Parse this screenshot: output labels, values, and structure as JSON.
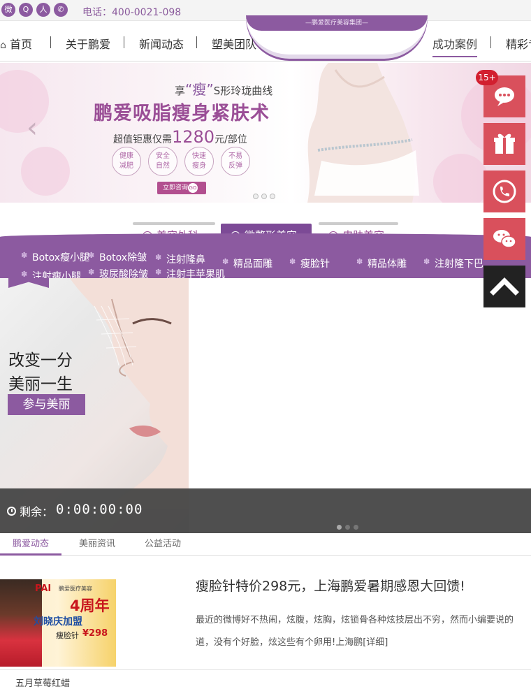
{
  "topbar": {
    "social_icons": [
      "weibo-icon",
      "qzone-icon",
      "renren-icon",
      "wechat-icon"
    ],
    "phone_text": "电话：400-0021-098"
  },
  "nav": {
    "items": [
      "首页",
      "关于鹏爱",
      "新闻动态",
      "塑美团队",
      "成功案例",
      "精彩专题"
    ],
    "active_index": 4,
    "emblem_text": "—鹏爱医疗美容集团—"
  },
  "banner": {
    "subtitle_pre": "享",
    "subtitle_highlight": "“瘦”",
    "subtitle_post": "S形玲珑曲线",
    "title": "鹏爱吸脂瘦身紧肤术",
    "price_pre": "超值钜惠仅需",
    "price_num": "1280",
    "price_post": "元/部位",
    "tags": [
      "健康\n减肥",
      "安全\n自然",
      "快速\n瘦身",
      "不易\n反弹"
    ],
    "cta": "立即咨询",
    "cta_go": "GO",
    "accent": "#9a4e96"
  },
  "tabs": {
    "items": [
      "美容外科",
      "微整形美容",
      "皮肤美容"
    ],
    "active_index": 1
  },
  "subnav": {
    "items": [
      "Botox瘦小腿",
      "Botox除皱",
      "注射隆鼻",
      "精品面雕",
      "瘦脸针",
      "精品体雕",
      "注射隆下巴",
      "注射瘦小腿",
      "玻尿酸除皱",
      "注射丰苹果肌"
    ]
  },
  "promo": {
    "line1": "改变一分",
    "line2": "美丽一生",
    "button": "参与美丽",
    "remain_label": "剩余：",
    "timer": "0:00:00:00"
  },
  "news": {
    "tabs": [
      "鹏爱动态",
      "美丽资讯",
      "公益活动"
    ],
    "active_index": 0,
    "thumb_brand": "PAI",
    "thumb_sub": "鹏爱医疗美容",
    "thumb_headline": "4周年",
    "thumb_celebrity": "刘晓庆加盟",
    "thumb_item": "瘦脸针",
    "thumb_price": "¥298",
    "title": "瘦脸针特价298元，上海鹏爱暑期感恩大回馈!",
    "body_line1": "最近的微博好不热闹，炫腹，炫胸，炫锁骨各种炫技层出不穷，然而小编要说的",
    "body_line2": "道，没有个好脸，炫这些有个卵用!上海鹏[详细]",
    "foot_left": "五月草莓红蜡"
  },
  "floating": {
    "badge": "15+",
    "buttons": [
      "chat-icon",
      "gift-icon",
      "phone-icon",
      "wechat-icon",
      "back-to-top-icon"
    ],
    "button_color": "#d9505c"
  },
  "colors": {
    "brand": "#8c5aa0",
    "text": "#333333"
  }
}
